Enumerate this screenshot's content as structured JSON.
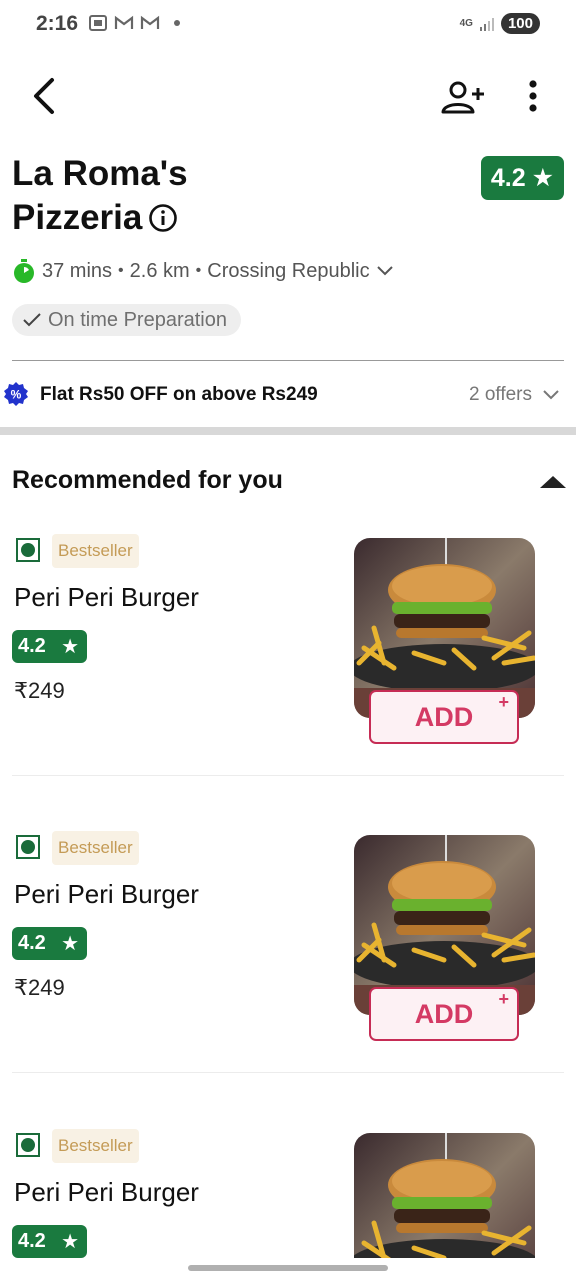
{
  "status_bar": {
    "time": "2:16",
    "network": "4G",
    "battery": "100"
  },
  "restaurant": {
    "name_line1": "La Roma's",
    "name_line2": "Pizzeria",
    "rating": "4.2",
    "delivery_time": "37 mins",
    "distance": "2.6 km",
    "location": "Crossing Republic",
    "prep_badge": "On time Preparation"
  },
  "offer": {
    "text": "Flat Rs50 OFF on above Rs249",
    "count": "2 offers"
  },
  "section": {
    "title": "Recommended for you"
  },
  "items": [
    {
      "badge": "Bestseller",
      "name": "Peri Peri Burger",
      "rating": "4.2",
      "price": "₹249",
      "add_label": "ADD"
    },
    {
      "badge": "Bestseller",
      "name": "Peri Peri Burger",
      "rating": "4.2",
      "price": "₹249",
      "add_label": "ADD"
    },
    {
      "badge": "Bestseller",
      "name": "Peri Peri Burger",
      "rating": "4.2"
    }
  ],
  "colors": {
    "rating_green": "#1a7a3f",
    "veg_green": "#1a6b3a",
    "add_pink": "#d43a64",
    "offer_blue": "#2233cc"
  }
}
